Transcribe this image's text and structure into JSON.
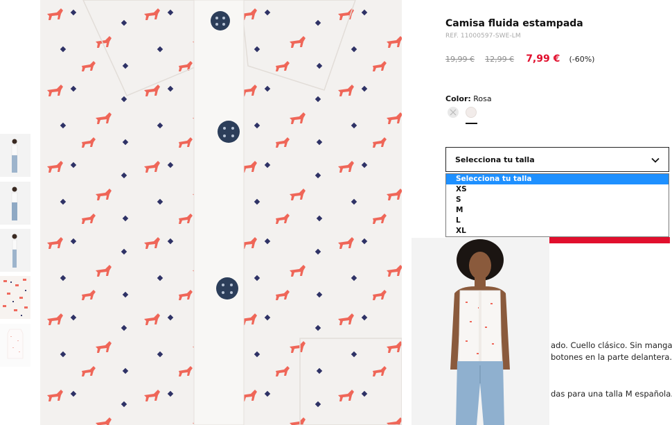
{
  "thumbnails": [
    {
      "alt": "model-front"
    },
    {
      "alt": "model-full"
    },
    {
      "alt": "model-side"
    },
    {
      "alt": "fabric-detail"
    },
    {
      "alt": "shirt-flat"
    }
  ],
  "product": {
    "title": "Camisa fluida estampada",
    "ref": "REF. 11000597-SWE-LM",
    "price_original": "19,99 €",
    "price_previous": "12,99 €",
    "price_current": "7,99 €",
    "discount": "(-60%)"
  },
  "color": {
    "label": "Color:",
    "value": "Rosa"
  },
  "size": {
    "placeholder": "Selecciona tu talla",
    "options": [
      "Selecciona tu talla",
      "XS",
      "S",
      "M",
      "L",
      "XL"
    ]
  },
  "description": {
    "line1": "ado. Cuello clásico. Sin mangas.",
    "line2": "botones en la parte delantera.",
    "line3": "das para una talla M española."
  },
  "colors": {
    "accent_red": "#e10f2d",
    "selected_option": "#1e90ff"
  }
}
